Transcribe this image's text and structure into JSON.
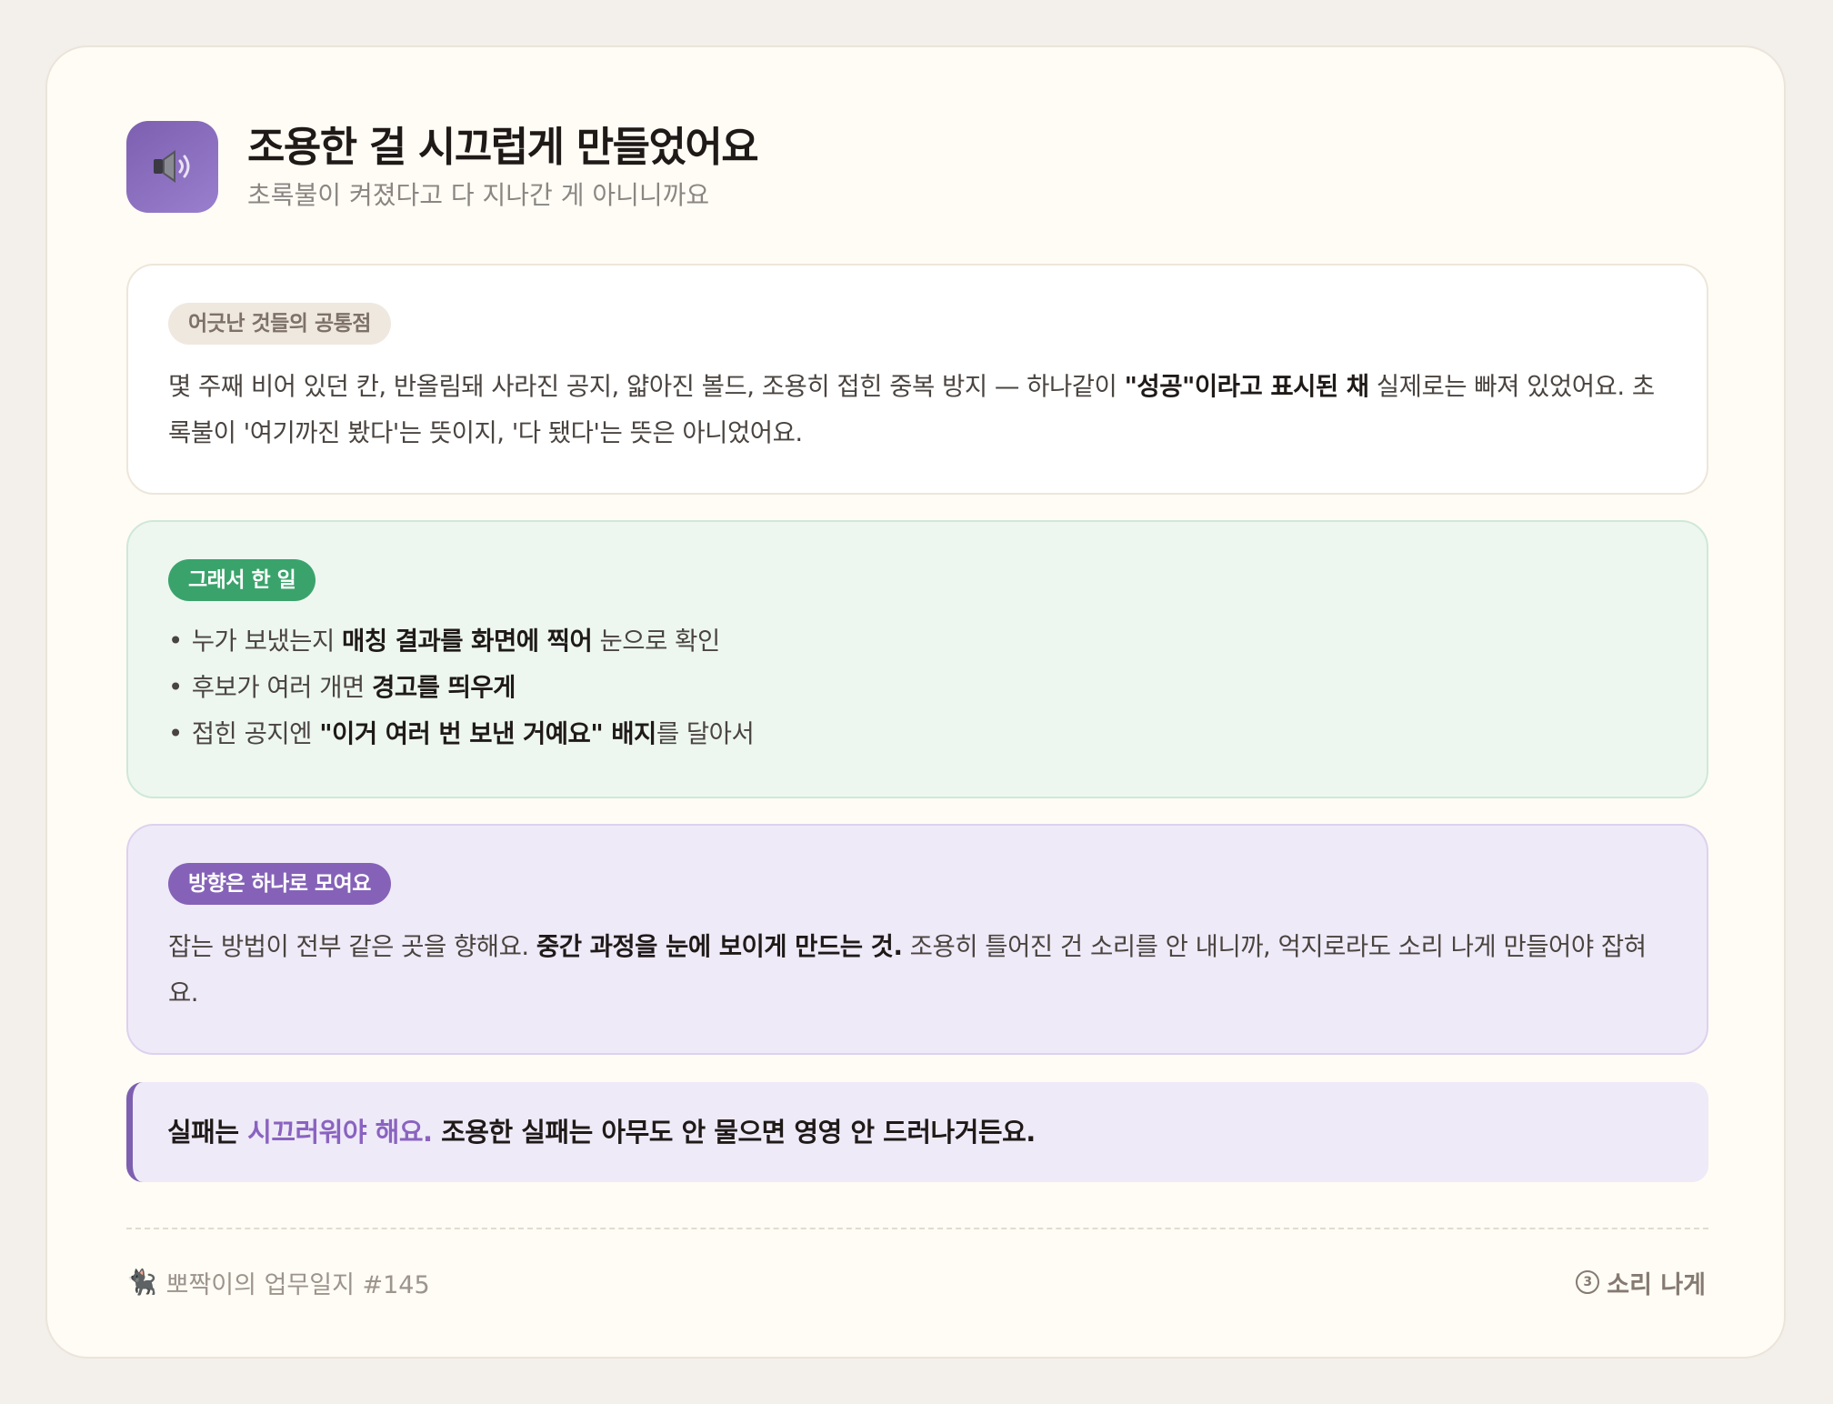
{
  "header": {
    "icon": "speaker-icon",
    "title": "조용한 걸 시끄럽게 만들었어요",
    "subtitle": "초록불이 켜졌다고 다 지나간 게 아니니까요"
  },
  "sections": {
    "common": {
      "badge": "어긋난 것들의 공통점",
      "text_1": "몇 주째 비어 있던 칸, 반올림돼 사라진 공지, 얇아진 볼드, 조용히 접힌 중복 방지 — 하나같이 ",
      "text_bold": "\"성공\"이라고 표시된 채",
      "text_2": " 실제로는 빠져 있었어요. 초록불이 '여기까진 봤다'는 뜻이지, '다 됐다'는 뜻은 아니었어요."
    },
    "done": {
      "badge": "그래서 한 일",
      "items": [
        {
          "pre": "누가 보냈는지 ",
          "bold": "매칭 결과를 화면에 찍어",
          "post": " 눈으로 확인"
        },
        {
          "pre": "후보가 여러 개면 ",
          "bold": "경고를 띄우게",
          "post": ""
        },
        {
          "pre": "접힌 공지엔 ",
          "bold": "\"이거 여러 번 보낸 거예요\" 배지",
          "post": "를 달아서"
        }
      ]
    },
    "direction": {
      "badge": "방향은 하나로 모여요",
      "text_1": "잡는 방법이 전부 같은 곳을 향해요. ",
      "text_bold": "중간 과정을 눈에 보이게 만드는 것.",
      "text_2": " 조용히 틀어진 건 소리를 안 내니까, 억지로라도 소리 나게 만들어야 잡혀요."
    }
  },
  "callout": {
    "text_1": "실패는 ",
    "accent": "시끄러워야 해요.",
    "text_2": " 조용한 실패는 아무도 안 물으면 영영 안 드러나거든요."
  },
  "footer": {
    "icon": "cat-icon",
    "left_label": "뽀짝이의 업무일지 #145",
    "right_number": "3",
    "right_label": "소리 나게"
  },
  "colors": {
    "accent_purple": "#8562b8",
    "accent_green": "#3aa36b",
    "background": "#fffcf5"
  }
}
